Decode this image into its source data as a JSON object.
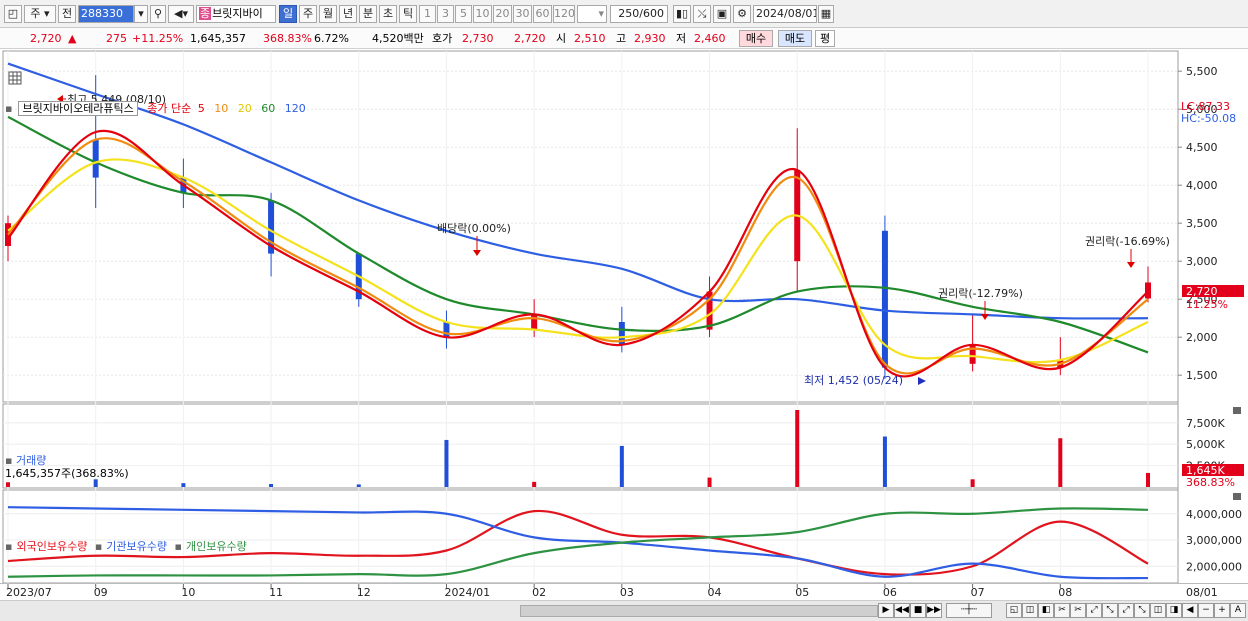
{
  "toolbar": {
    "market_label": "주",
    "prev_label": "전",
    "code": "288330",
    "name": "브릿지바이",
    "name_badge": "종",
    "periods": [
      "일",
      "주",
      "월",
      "년",
      "분",
      "초",
      "틱"
    ],
    "selected_period": "일",
    "intervals": [
      "1",
      "3",
      "5",
      "10",
      "20",
      "30",
      "60",
      "120"
    ],
    "count": "250/600",
    "date": "2024/08/01"
  },
  "info": {
    "price": "2,720",
    "change_arrow": "▲",
    "change": "275",
    "change_pct": "+11.25%",
    "volume": "1,645,357",
    "volume_ratio": "368.83%",
    "turnover": "6.72%",
    "amount": "4,520백만",
    "quote_label": "호가",
    "ask": "2,730",
    "bid": "2,720",
    "open_label": "시",
    "open": "2,510",
    "high_label": "고",
    "high": "2,930",
    "low_label": "저",
    "low": "2,460",
    "buy_button": "매수",
    "sell_button": "매도",
    "eval_button": "평"
  },
  "price_panel": {
    "stock_name": "브릿지바이오테라퓨틱스",
    "legend_prefix": "종가 단순",
    "ma_labels": [
      "5",
      "10",
      "20",
      "60",
      "120"
    ],
    "ma_colors": [
      "#e5000d",
      "#f08b10",
      "#f4e21c",
      "#1f8a2c",
      "#2e5fe3"
    ],
    "lc": "LC:87.33",
    "hc": "HC:-50.08",
    "current_price": "2,720",
    "current_change": "11.25%",
    "y_ticks": [
      "5,500",
      "5,000",
      "4,500",
      "4,000",
      "3,500",
      "3,000",
      "2,500",
      "2,000",
      "1,500"
    ],
    "annotations": {
      "high": "최고 5,449 (08/10)",
      "low": "최저 1,452 (05/24)",
      "dividend": "배당락(0.00%)",
      "rights1": "권리락(-12.79%)",
      "rights2": "권리락(-16.69%)"
    }
  },
  "volume_panel": {
    "title": "거래량",
    "value": "1,645,357주(368.83%)",
    "y_ticks": [
      "7,500K",
      "5,000K",
      "2,500K"
    ],
    "current": "1,645K",
    "current_pct": "368.83%"
  },
  "holding_panel": {
    "series_names": [
      "외국인보유수량",
      "기관보유수량",
      "개인보유수량"
    ],
    "series_colors": [
      "#e1141e",
      "#2f5ee5",
      "#2e9243"
    ],
    "y_ticks": [
      "4,000,000",
      "3,000,000",
      "2,000,000"
    ]
  },
  "date_axis": {
    "labels": [
      "2023/07",
      "09",
      "10",
      "11",
      "12",
      "2024/01",
      "02",
      "03",
      "04",
      "05",
      "06",
      "07",
      "08"
    ],
    "right_label": "08/01"
  },
  "chart_data": [
    {
      "type": "line",
      "title": "브릿지바이오테라퓨틱스",
      "x": [
        "2023/07",
        "2023/08",
        "2023/09",
        "2023/10",
        "2023/11",
        "2023/12",
        "2024/01",
        "2024/02",
        "2024/03",
        "2024/04",
        "2024/05",
        "2024/06",
        "2024/07",
        "2024/08"
      ],
      "ylim": [
        1200,
        5700
      ],
      "series": [
        {
          "name": "5",
          "values": [
            3300,
            4700,
            4000,
            3200,
            2600,
            2000,
            2300,
            1900,
            2600,
            4200,
            1600,
            1900,
            1600,
            2600
          ]
        },
        {
          "name": "10",
          "values": [
            3350,
            4600,
            4050,
            3250,
            2650,
            2050,
            2250,
            1950,
            2500,
            4100,
            1650,
            1850,
            1650,
            2500
          ]
        },
        {
          "name": "20",
          "values": [
            3400,
            4300,
            4100,
            3400,
            2800,
            2200,
            2100,
            2000,
            2300,
            3600,
            1900,
            1750,
            1700,
            2200
          ]
        },
        {
          "name": "60",
          "values": [
            4900,
            4300,
            3900,
            3800,
            3100,
            2500,
            2300,
            2100,
            2150,
            2600,
            2650,
            2400,
            2200,
            1800
          ]
        },
        {
          "name": "120",
          "values": [
            5600,
            5200,
            4800,
            4300,
            3800,
            3400,
            3100,
            2900,
            2500,
            2500,
            2350,
            2300,
            2250,
            2250
          ]
        }
      ],
      "candles": [
        {
          "date": "2023/07",
          "open": 3200,
          "high": 3600,
          "low": 3000,
          "close": 3500
        },
        {
          "date": "2023/08",
          "open": 4600,
          "high": 5449,
          "low": 3700,
          "close": 4100
        },
        {
          "date": "2023/09",
          "open": 4100,
          "high": 4350,
          "low": 3700,
          "close": 3900
        },
        {
          "date": "2023/10",
          "open": 3800,
          "high": 3900,
          "low": 2800,
          "close": 3100
        },
        {
          "date": "2023/11",
          "open": 3100,
          "high": 3050,
          "low": 2400,
          "close": 2500
        },
        {
          "date": "2023/12",
          "open": 2200,
          "high": 2350,
          "low": 1850,
          "close": 2000
        },
        {
          "date": "2024/01",
          "open": 2100,
          "high": 2500,
          "low": 2000,
          "close": 2300
        },
        {
          "date": "2024/02",
          "open": 2200,
          "high": 2400,
          "low": 1800,
          "close": 1900
        },
        {
          "date": "2024/03",
          "open": 2100,
          "high": 2800,
          "low": 2000,
          "close": 2600
        },
        {
          "date": "2024/04",
          "open": 3000,
          "high": 4750,
          "low": 2600,
          "close": 4200
        },
        {
          "date": "2024/05",
          "open": 3400,
          "high": 3600,
          "low": 1452,
          "close": 1600
        },
        {
          "date": "2024/06",
          "open": 1650,
          "high": 2300,
          "low": 1550,
          "close": 1900
        },
        {
          "date": "2024/07",
          "open": 1600,
          "high": 2000,
          "low": 1500,
          "close": 1700
        },
        {
          "date": "2024/08",
          "open": 2510,
          "high": 2930,
          "low": 2460,
          "close": 2720
        }
      ],
      "annotations": [
        {
          "text": "최고 5,449 (08/10)",
          "x": "2023/08",
          "y": 5449
        },
        {
          "text": "배당락(0.00%)",
          "x": "2023/12",
          "y": 3150
        },
        {
          "text": "최저 1,452 (05/24)",
          "x": "2024/05",
          "y": 1452
        },
        {
          "text": "권리락(-12.79%)",
          "x": "2024/06",
          "y": 2300
        },
        {
          "text": "권리락(-16.69%)",
          "x": "2024/07",
          "y": 2950
        }
      ]
    },
    {
      "type": "bar",
      "title": "거래량",
      "ylim": [
        0,
        9000
      ],
      "unit": "K",
      "bars": [
        {
          "date": "2023/07",
          "value": 550
        },
        {
          "date": "2023/08",
          "value": 900
        },
        {
          "date": "2023/09",
          "value": 450
        },
        {
          "date": "2023/10",
          "value": 350
        },
        {
          "date": "2023/11",
          "value": 300
        },
        {
          "date": "2023/12",
          "value": 5500
        },
        {
          "date": "2024/01",
          "value": 600
        },
        {
          "date": "2024/02",
          "value": 4800
        },
        {
          "date": "2024/03",
          "value": 1100
        },
        {
          "date": "2024/04",
          "value": 9000
        },
        {
          "date": "2024/05",
          "value": 5900
        },
        {
          "date": "2024/06",
          "value": 900
        },
        {
          "date": "2024/07",
          "value": 5700
        },
        {
          "date": "2024/08",
          "value": 1645
        }
      ]
    },
    {
      "type": "line",
      "title": "",
      "x": [
        "2023/07",
        "2023/08",
        "2023/09",
        "2023/10",
        "2023/11",
        "2023/12",
        "2024/01",
        "2024/02",
        "2024/03",
        "2024/04",
        "2024/05",
        "2024/06",
        "2024/07",
        "2024/08"
      ],
      "ylim": [
        1400000,
        4600000
      ],
      "series": [
        {
          "name": "외국인보유수량",
          "values": [
            2200000,
            2400000,
            2350000,
            2500000,
            2400000,
            2600000,
            4100000,
            3200000,
            3100000,
            2300000,
            1700000,
            2000000,
            3700000,
            2100000
          ]
        },
        {
          "name": "기관보유수량",
          "values": [
            4250000,
            4200000,
            4150000,
            4100000,
            4050000,
            4000000,
            3100000,
            2900000,
            2600000,
            2300000,
            1600000,
            2100000,
            1600000,
            1550000
          ]
        },
        {
          "name": "개인보유수량",
          "values": [
            1600000,
            1650000,
            1650000,
            1650000,
            1700000,
            1700000,
            2500000,
            2900000,
            3100000,
            3300000,
            4000000,
            4000000,
            4200000,
            4150000
          ]
        }
      ]
    }
  ]
}
